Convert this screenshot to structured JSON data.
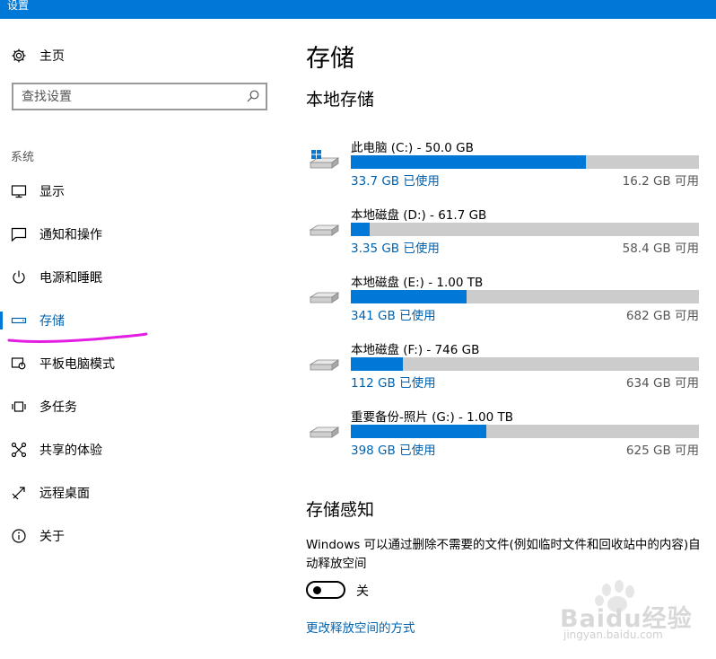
{
  "window": {
    "title": "设置",
    "accent_color": "#0078d7"
  },
  "sidebar": {
    "home": {
      "label": "主页",
      "icon": "gear-icon"
    },
    "search": {
      "placeholder": "查找设置",
      "icon": "search-icon"
    },
    "section_label": "系统",
    "items": [
      {
        "label": "显示",
        "icon": "monitor-icon",
        "active": false
      },
      {
        "label": "通知和操作",
        "icon": "notification-icon",
        "active": false
      },
      {
        "label": "电源和睡眠",
        "icon": "power-icon",
        "active": false
      },
      {
        "label": "存储",
        "icon": "storage-icon",
        "active": true
      },
      {
        "label": "平板电脑模式",
        "icon": "tablet-mode-icon",
        "active": false
      },
      {
        "label": "多任务",
        "icon": "multitask-icon",
        "active": false
      },
      {
        "label": "共享的体验",
        "icon": "share-icon",
        "active": false
      },
      {
        "label": "远程桌面",
        "icon": "remote-desktop-icon",
        "active": false
      },
      {
        "label": "关于",
        "icon": "info-icon",
        "active": false
      }
    ]
  },
  "main": {
    "title": "存储",
    "local_storage_heading": "本地存储",
    "drives": [
      {
        "name": "此电脑 (C:) - 50.0 GB",
        "used": "33.7 GB 已使用",
        "available": "16.2 GB 可用",
        "used_fraction": 0.674,
        "icon": "windows-drive-icon"
      },
      {
        "name": "本地磁盘 (D:) - 61.7 GB",
        "used": "3.35 GB 已使用",
        "available": "58.4 GB 可用",
        "used_fraction": 0.054,
        "icon": "drive-icon"
      },
      {
        "name": "本地磁盘 (E:) - 1.00 TB",
        "used": "341 GB 已使用",
        "available": "682 GB 可用",
        "used_fraction": 0.333,
        "icon": "drive-icon"
      },
      {
        "name": "本地磁盘 (F:) - 746 GB",
        "used": "112 GB 已使用",
        "available": "634 GB 可用",
        "used_fraction": 0.15,
        "icon": "drive-icon"
      },
      {
        "name": "重要备份-照片 (G:) - 1.00 TB",
        "used": "398 GB 已使用",
        "available": "625 GB 可用",
        "used_fraction": 0.389,
        "icon": "drive-icon"
      }
    ],
    "storage_sense": {
      "heading": "存储感知",
      "description": "Windows 可以通过删除不需要的文件(例如临时文件和回收站中的内容)自动释放空间",
      "toggle_state": "关",
      "link": "更改释放空间的方式"
    }
  },
  "watermark": {
    "text": "Baidu经验",
    "sub": "jingyan.baidu.com"
  }
}
